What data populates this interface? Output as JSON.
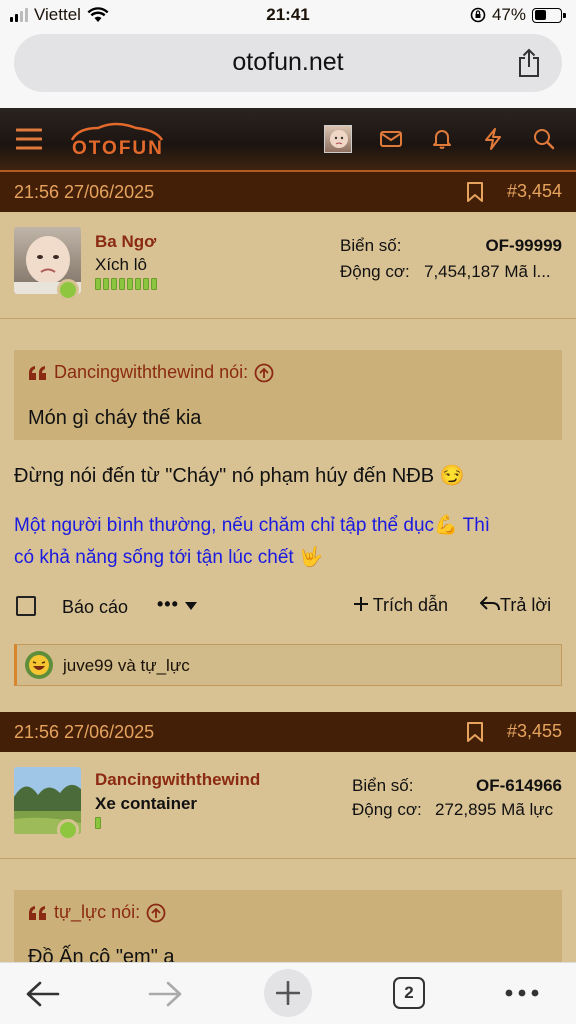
{
  "status_bar": {
    "carrier": "Viettel",
    "time": "21:41",
    "battery": "47%",
    "battery_level": 0.47
  },
  "browser": {
    "url": "otofun.net",
    "tab_count": "2"
  },
  "site": {
    "logo_text": "OTOFUN"
  },
  "posts": [
    {
      "date": "21:56 27/06/2025",
      "number": "#3,454",
      "username": "Ba Ngơ",
      "user_title": "Xích lô",
      "bars": 8,
      "plate_label": "Biển số:",
      "plate_value": "OF-99999",
      "engine_label": "Động cơ:",
      "engine_value": "7,454,187 Mã l...",
      "quote_author": "Dancingwiththewind nói:",
      "quote_text": "Món gì cháy thế kia",
      "body": "Đừng nói đến từ \"Cháy\" nó phạm húy đến NĐB 😏",
      "signature_line1": "Một người bình thường, nếu chăm chỉ tập thể dục💪 Thì",
      "signature_line2": "có khả năng sống tới tận lúc chết 🤟",
      "report": "Báo cáo",
      "more": "•••",
      "quote_btn": "Trích dẫn",
      "reply_btn": "Trả lời",
      "reactions": "juve99 và tự_lực"
    },
    {
      "date": "21:56 27/06/2025",
      "number": "#3,455",
      "username": "Dancingwiththewind",
      "user_title": "Xe container",
      "bars": 1,
      "plate_label": "Biển số:",
      "plate_value": "OF-614966",
      "engine_label": "Động cơ:",
      "engine_value": "272,895 Mã lực",
      "quote_author": "tự_lực nói:",
      "quote_text": "Đồ Ấn cô \"em\" a"
    }
  ]
}
